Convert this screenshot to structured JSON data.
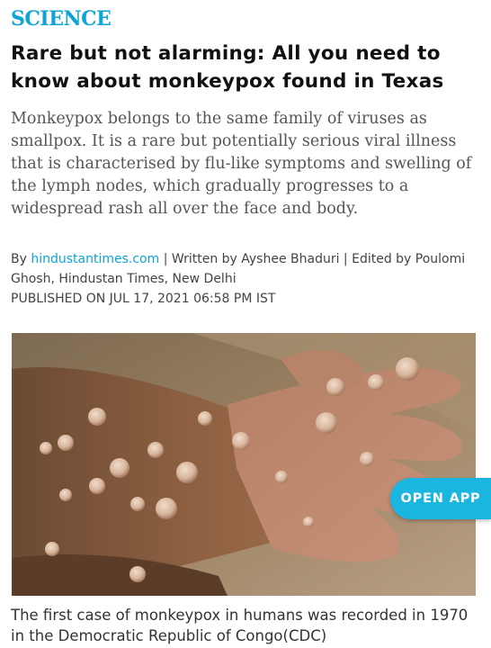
{
  "article": {
    "section": "SCIENCE",
    "headline": "Rare but not alarming: All you need to know about monkeypox found in Texas",
    "summary": "Monkeypox belongs to the same family of viruses as smallpox. It is a rare but potentially serious viral illness that is characterised by flu-like symptoms and swelling of the lymph nodes, which gradually progresses to a widespread rash all over the face and body.",
    "byline": {
      "by_prefix": "By",
      "source_link": "hindustantimes.com",
      "written_by": " | Written by Ayshee Bhaduri | Edited by Poulomi Ghosh, Hindustan Times, New Delhi",
      "published": "PUBLISHED ON JUL 17, 2021 06:58 PM IST"
    },
    "image_caption": "The first case of monkeypox in humans was recorded in 1970 in the Democratic Republic of Congo(CDC)"
  },
  "open_app_button": {
    "label": "OPEN APP",
    "color": "#1bb6e0"
  },
  "colors": {
    "accent": "#0ea5d6"
  }
}
